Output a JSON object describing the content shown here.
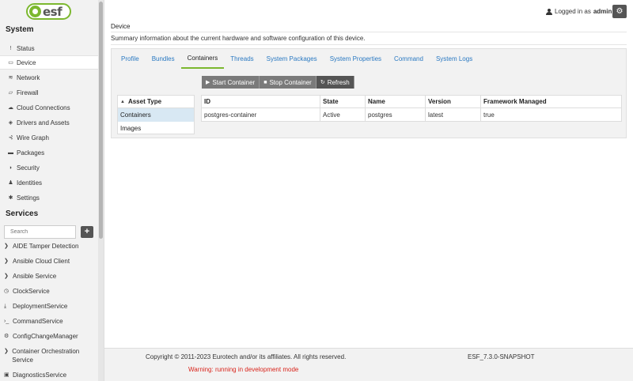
{
  "sidebar": {
    "logo_text": "esf",
    "system_title": "System",
    "system_items": [
      {
        "label": "Status",
        "icon": "exclamation-icon"
      },
      {
        "label": "Device",
        "icon": "device-icon"
      },
      {
        "label": "Network",
        "icon": "wifi-icon"
      },
      {
        "label": "Firewall",
        "icon": "firewall-icon"
      },
      {
        "label": "Cloud Connections",
        "icon": "cloud-icon"
      },
      {
        "label": "Drivers and Assets",
        "icon": "cube-icon"
      },
      {
        "label": "Wire Graph",
        "icon": "graph-icon"
      },
      {
        "label": "Packages",
        "icon": "package-icon"
      },
      {
        "label": "Security",
        "icon": "shield-icon"
      },
      {
        "label": "Identities",
        "icon": "user-icon"
      },
      {
        "label": "Settings",
        "icon": "gear-icon"
      }
    ],
    "services_title": "Services",
    "search_placeholder": "Search",
    "add_label": "+",
    "services": [
      {
        "label": "AIDE Tamper Detection",
        "icon": "circle-chevron-icon"
      },
      {
        "label": "Ansible Cloud Client",
        "icon": "circle-chevron-icon"
      },
      {
        "label": "Ansible Service",
        "icon": "circle-chevron-icon"
      },
      {
        "label": "ClockService",
        "icon": "clock-icon"
      },
      {
        "label": "DeploymentService",
        "icon": "download-icon"
      },
      {
        "label": "CommandService",
        "icon": "terminal-icon"
      },
      {
        "label": "ConfigChangeManager",
        "icon": "config-icon"
      },
      {
        "label": "Container Orchestration Service",
        "icon": "circle-chevron-icon"
      },
      {
        "label": "DiagnosticsService",
        "icon": "diagnostics-icon"
      }
    ]
  },
  "header": {
    "logged_in_as": "Logged in as",
    "username": "admin"
  },
  "page": {
    "title": "Device",
    "description": "Summary information about the current hardware and software configuration of this device."
  },
  "tabs": [
    "Profile",
    "Bundles",
    "Containers",
    "Threads",
    "System Packages",
    "System Properties",
    "Command",
    "System Logs"
  ],
  "active_tab": "Containers",
  "toolbar": {
    "start": "Start Container",
    "stop": "Stop Container",
    "refresh": "Refresh"
  },
  "asset_panel": {
    "header": "Asset Type",
    "rows": [
      "Containers",
      "Images"
    ],
    "selected": "Containers"
  },
  "table": {
    "columns": [
      "ID",
      "State",
      "Name",
      "Version",
      "Framework Managed"
    ],
    "rows": [
      [
        "postgres-container",
        "Active",
        "postgres",
        "latest",
        "true"
      ]
    ]
  },
  "footer": {
    "copyright": "Copyright © 2011-2023 Eurotech and/or its affiliates. All rights reserved.",
    "version": "ESF_7.3.0-SNAPSHOT",
    "warning": "Warning: running in development mode"
  },
  "colors": {
    "accent_green": "#7cb82f",
    "link_blue": "#2a79c2",
    "warning_red": "#d9251c",
    "button_dark": "#555555"
  }
}
